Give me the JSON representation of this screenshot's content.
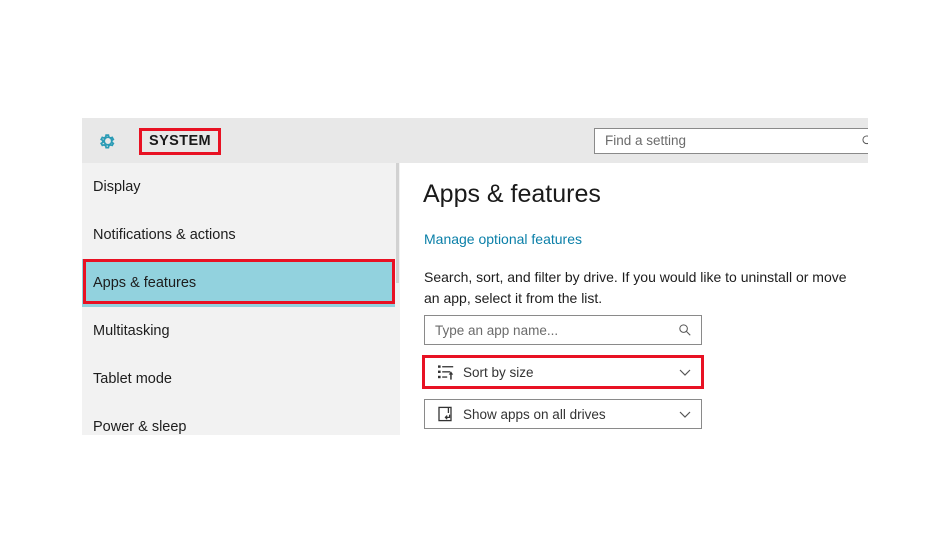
{
  "header": {
    "gear_icon": "gear-icon",
    "title": "SYSTEM",
    "search": {
      "placeholder": "Find a setting",
      "value": "",
      "icon": "search-icon"
    }
  },
  "sidebar": {
    "items": [
      {
        "label": "Display",
        "selected": false
      },
      {
        "label": "Notifications & actions",
        "selected": false
      },
      {
        "label": "Apps & features",
        "selected": true
      },
      {
        "label": "Multitasking",
        "selected": false
      },
      {
        "label": "Tablet mode",
        "selected": false
      },
      {
        "label": "Power & sleep",
        "selected": false
      }
    ],
    "scrollbar": "sidebar-scrollbar"
  },
  "main": {
    "title": "Apps & features",
    "link": "Manage optional features",
    "description": "Search, sort, and filter by drive. If you would like to uninstall or move an app, select it from the list.",
    "controls": {
      "search": {
        "placeholder": "Type an app name...",
        "value": "",
        "icon": "search-icon"
      },
      "sort": {
        "label": "Sort by size",
        "left_icon": "sort-ascending-icon",
        "right_icon": "chevron-down-icon"
      },
      "drives": {
        "label": "Show apps on all drives",
        "left_icon": "drive-icon",
        "right_icon": "chevron-down-icon"
      }
    }
  },
  "annotations": {
    "highlight_color": "#e81123",
    "highlights": [
      "system-title-highlight",
      "apps-features-nav-highlight",
      "sort-by-size-highlight"
    ]
  },
  "colors": {
    "accent_teal": "#92d2de",
    "link_blue": "#0a7fa8",
    "header_bg": "#e8e8e8",
    "sidebar_bg": "#f2f2f2",
    "gear_teal": "#2a9bb5"
  }
}
